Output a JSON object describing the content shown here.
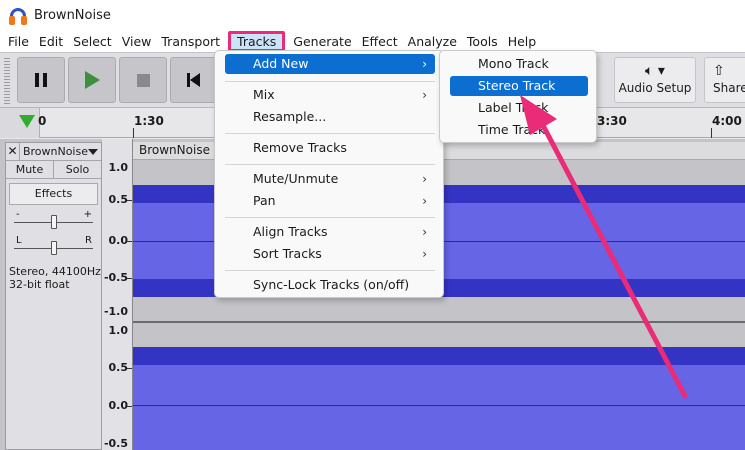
{
  "window": {
    "title": "BrownNoise"
  },
  "menubar": [
    "File",
    "Edit",
    "Select",
    "View",
    "Transport",
    "Tracks",
    "Generate",
    "Effect",
    "Analyze",
    "Tools",
    "Help"
  ],
  "toolbar": {
    "audio_setup_label": "Audio Setup",
    "share_audio_label": "Share A"
  },
  "timeline": {
    "ticks": [
      "0",
      "1:30",
      "3:30",
      "4:00"
    ]
  },
  "track": {
    "name": "BrownNoise",
    "mute": "Mute",
    "solo": "Solo",
    "effects": "Effects",
    "gain_minus": "-",
    "gain_plus": "+",
    "pan_left": "L",
    "pan_right": "R",
    "info_line1": "Stereo, 44100Hz",
    "info_line2": "32-bit float",
    "clip_name": "BrownNoise",
    "ruler_labels": [
      "1.0",
      "0.5",
      "0.0",
      "-0.5",
      "-1.0",
      "1.0",
      "0.5",
      "0.0",
      "-0.5"
    ]
  },
  "tracks_menu": {
    "items": [
      {
        "label": "Add New",
        "submenu": true,
        "highlighted": true
      },
      {
        "label": "Mix",
        "submenu": true
      },
      {
        "label": "Resample...",
        "submenu": false
      },
      {
        "label": "Remove Tracks",
        "submenu": false
      },
      {
        "label": "Mute/Unmute",
        "submenu": true
      },
      {
        "label": "Pan",
        "submenu": true
      },
      {
        "label": "Align Tracks",
        "submenu": true
      },
      {
        "label": "Sort Tracks",
        "submenu": true
      },
      {
        "label": "Sync-Lock Tracks (on/off)",
        "submenu": false
      }
    ]
  },
  "add_new_submenu": {
    "items": [
      {
        "label": "Mono Track"
      },
      {
        "label": "Stereo Track",
        "highlighted": true
      },
      {
        "label": "Label Track"
      },
      {
        "label": "Time Track"
      }
    ]
  },
  "colors": {
    "menu_highlight": "#0d6ed1",
    "annotation": "#ea2b78",
    "waveform_outer": "#3434c4",
    "waveform_inner": "#6565e6"
  }
}
